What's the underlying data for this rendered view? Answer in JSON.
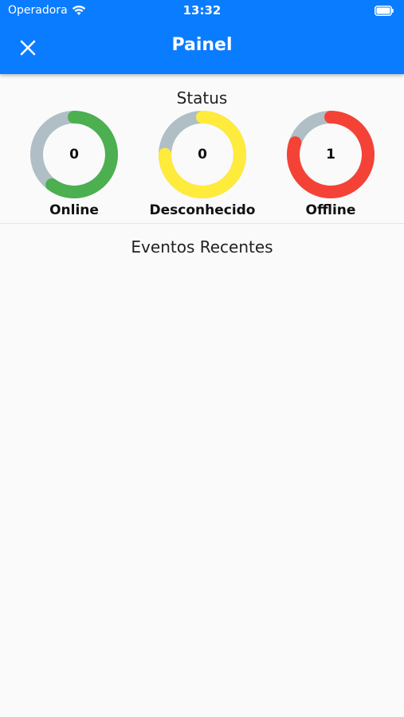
{
  "status_bar": {
    "carrier": "Operadora",
    "time": "13:32",
    "icons": [
      "wifi-icon",
      "battery-icon"
    ]
  },
  "app_bar": {
    "title": "Painel",
    "close_icon": "close-icon",
    "background": "#0a7cff"
  },
  "status_section": {
    "title": "Status",
    "gauges": [
      {
        "label": "Online",
        "count": "0",
        "fraction": 0.6,
        "color": "#4caf50"
      },
      {
        "label": "Desconhecido",
        "count": "0",
        "fraction": 0.75,
        "color": "#ffeb3b"
      },
      {
        "label": "Offline",
        "count": "1",
        "fraction": 0.8,
        "color": "#f44336"
      }
    ],
    "track_color": "#b0bec5"
  },
  "events_section": {
    "title": "Eventos Recentes"
  }
}
